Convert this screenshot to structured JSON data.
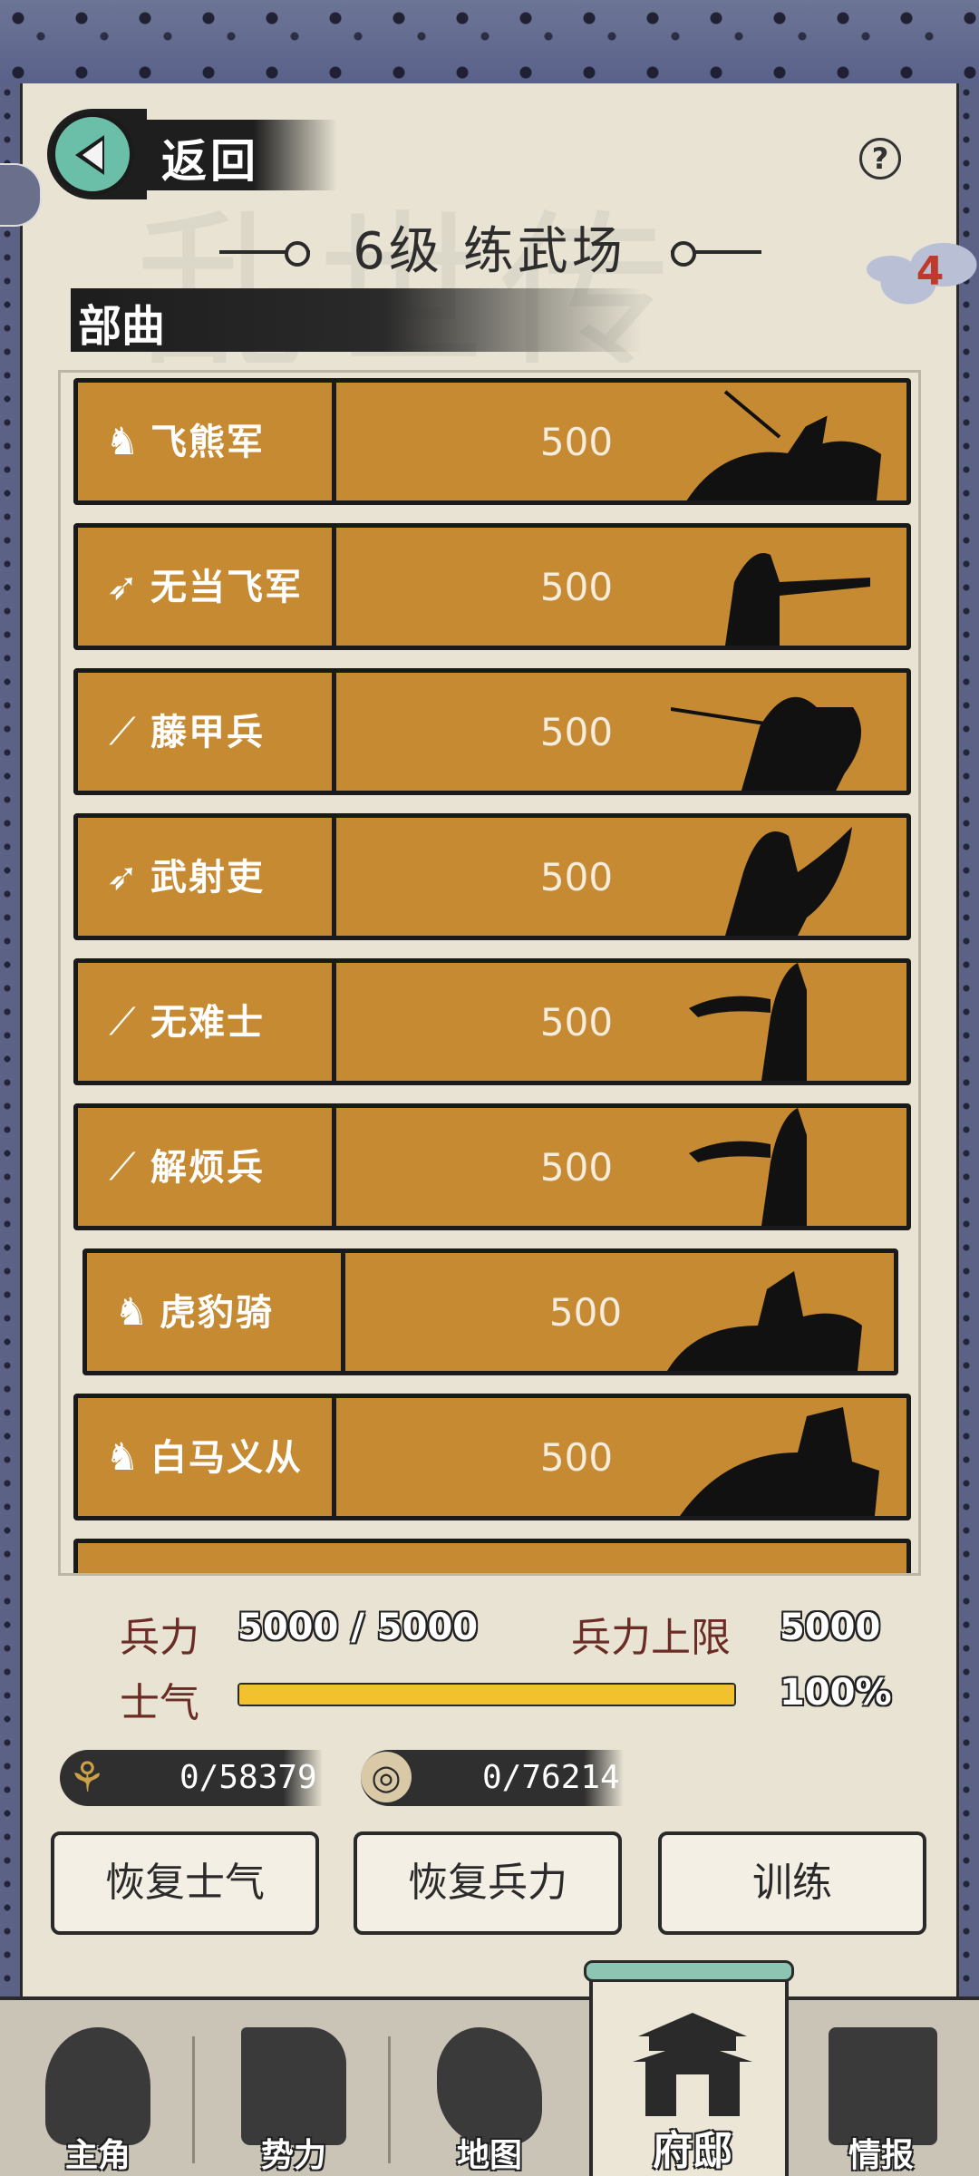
{
  "header": {
    "back_label": "返回",
    "help_symbol": "?",
    "title": "6级  练武场",
    "badge_count": "4"
  },
  "section": {
    "title": "部曲"
  },
  "units": [
    {
      "name": "飞熊军",
      "count": "500",
      "icon": "horse-head-icon"
    },
    {
      "name": "无当飞军",
      "count": "500",
      "icon": "bow-icon"
    },
    {
      "name": "藤甲兵",
      "count": "500",
      "icon": "spear-icon"
    },
    {
      "name": "武射吏",
      "count": "500",
      "icon": "bow-icon"
    },
    {
      "name": "无难士",
      "count": "500",
      "icon": "spear-icon"
    },
    {
      "name": "解烦兵",
      "count": "500",
      "icon": "spear-icon"
    },
    {
      "name": "虎豹骑",
      "count": "500",
      "icon": "horse-head-icon"
    },
    {
      "name": "白马义从",
      "count": "500",
      "icon": "horse-bow-icon"
    }
  ],
  "stats": {
    "troops_label": "兵力",
    "troops_value": "5000 / 5000",
    "troops_cap_label": "兵力上限",
    "troops_cap_value": "5000",
    "morale_label": "士气",
    "morale_value": "100%",
    "morale_fraction": 1.0
  },
  "resources": {
    "grain": {
      "icon": "grain-icon",
      "text": "0/58379"
    },
    "coin": {
      "icon": "coin-icon",
      "text": "0/76214"
    }
  },
  "actions": {
    "restore_morale": "恢复士气",
    "restore_troops": "恢复兵力",
    "train": "训练"
  },
  "nav": {
    "items": [
      {
        "label": "主角"
      },
      {
        "label": "势力"
      },
      {
        "label": "地图"
      },
      {
        "label": "府邸"
      },
      {
        "label": "情报"
      }
    ],
    "active_index": 3
  },
  "colors": {
    "row_fill": "#c68a33",
    "paper": "#e8e3d3",
    "morale_fill": "#f2c12e",
    "accent_teal": "#6bbfa8"
  }
}
